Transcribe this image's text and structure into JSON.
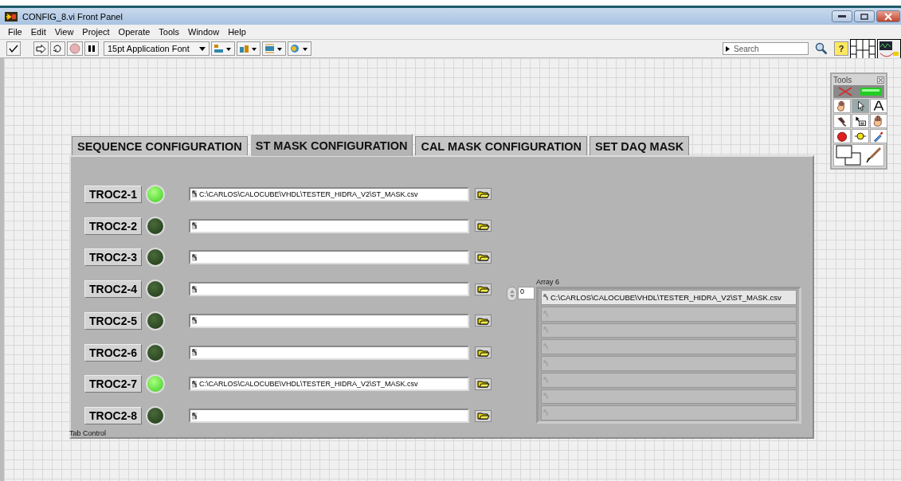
{
  "window": {
    "title": "CONFIG_8.vi Front Panel"
  },
  "menu": [
    "File",
    "Edit",
    "View",
    "Project",
    "Operate",
    "Tools",
    "Window",
    "Help"
  ],
  "toolbar": {
    "font_selector": "15pt Application Font",
    "search": {
      "placeholder": "Search"
    },
    "help_button": "?"
  },
  "tools_palette": {
    "title": "Tools"
  },
  "tabs": [
    {
      "label": "SEQUENCE CONFIGURATION",
      "selected": false
    },
    {
      "label": "ST MASK CONFIGURATION",
      "selected": true
    },
    {
      "label": "CAL MASK CONFIGURATION",
      "selected": false
    },
    {
      "label": "SET DAQ MASK",
      "selected": false
    }
  ],
  "rows": [
    {
      "label": "TROC2-1",
      "on": true,
      "path": "C:\\CARLOS\\CALOCUBE\\VHDL\\TESTER_HIDRA_V2\\ST_MASK.csv"
    },
    {
      "label": "TROC2-2",
      "on": false
    },
    {
      "label": "TROC2-3",
      "on": false
    },
    {
      "label": "TROC2-4",
      "on": false
    },
    {
      "label": "TROC2-5",
      "on": false
    },
    {
      "label": "TROC2-6",
      "on": false
    },
    {
      "label": "TROC2-7",
      "on": true,
      "path": "C:\\CARLOS\\CALOCUBE\\VHDL\\TESTER_HIDRA_V2\\ST_MASK.csv"
    },
    {
      "label": "TROC2-8",
      "on": false
    }
  ],
  "array": {
    "label": "Array 6",
    "index": "0",
    "elements": [
      {
        "value": "C:\\CARLOS\\CALOCUBE\\VHDL\\TESTER_HIDRA_V2\\ST_MASK.csv",
        "disabled": false
      },
      {
        "disabled": true
      },
      {
        "disabled": true
      },
      {
        "disabled": true
      },
      {
        "disabled": true
      },
      {
        "disabled": true
      },
      {
        "disabled": true
      },
      {
        "disabled": true
      }
    ]
  },
  "tab_control_label": "Tab Control"
}
